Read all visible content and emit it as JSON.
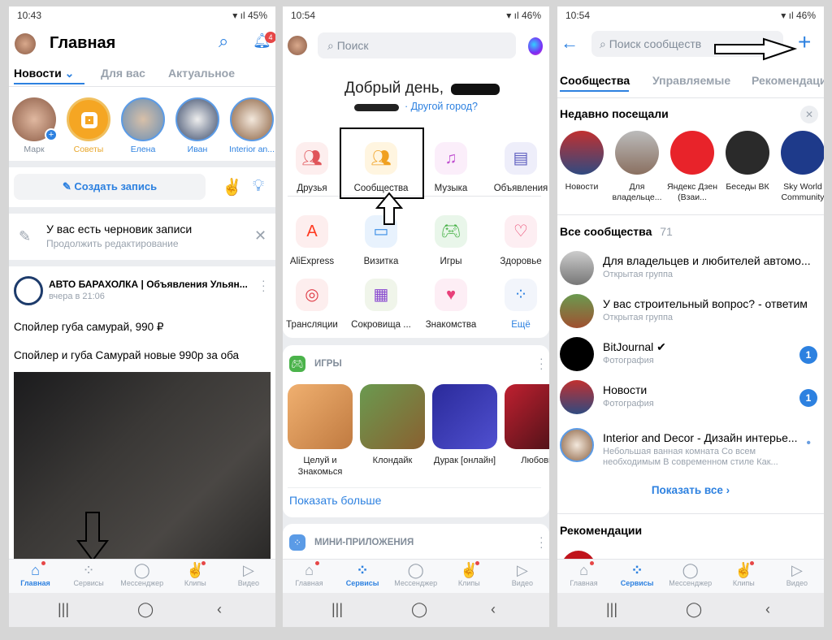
{
  "colors": {
    "accent": "#2d81e0",
    "badge": "#e64646",
    "background": "#d6d6d6"
  },
  "bottom_nav": [
    {
      "label": "Главная",
      "icon": "home-icon"
    },
    {
      "label": "Сервисы",
      "icon": "services-icon"
    },
    {
      "label": "Мессенджер",
      "icon": "messenger-icon"
    },
    {
      "label": "Клипы",
      "icon": "clips-icon"
    },
    {
      "label": "Видео",
      "icon": "video-icon"
    }
  ],
  "screen1": {
    "status": {
      "time": "10:43",
      "battery": "45%"
    },
    "title": "Главная",
    "notifications_badge": "4",
    "tabs": [
      "Новости",
      "Для вас",
      "Актуальное"
    ],
    "stories": [
      "Марк",
      "Советы",
      "Елена",
      "Иван",
      "Interior an..."
    ],
    "create_post": "Создать запись",
    "draft": {
      "title": "У вас есть черновик записи",
      "subtitle": "Продолжить редактирование"
    },
    "post": {
      "author": "АВТО БАРАХОЛКА | Объявления Ульян...",
      "time": "вчера в 21:06",
      "line1": "Спойлер губа самурай, 990 ₽",
      "line2": "Спойлер и губа Самурай новые 990р за оба"
    },
    "active_nav": "Главная"
  },
  "screen2": {
    "status": {
      "time": "10:54",
      "battery": "46%"
    },
    "search_placeholder": "Поиск",
    "greeting": "Добрый день,",
    "other_city": "· Другой город?",
    "services": [
      {
        "label": "Друзья",
        "icon": "friends-icon"
      },
      {
        "label": "Сообщества",
        "icon": "communities-icon"
      },
      {
        "label": "Музыка",
        "icon": "music-icon"
      },
      {
        "label": "Объявления",
        "icon": "ads-icon"
      },
      {
        "label": "AliExpress",
        "icon": "aliexpress-icon"
      },
      {
        "label": "Визитка",
        "icon": "card-icon"
      },
      {
        "label": "Игры",
        "icon": "gamepad-icon"
      },
      {
        "label": "Здоровье",
        "icon": "health-icon"
      },
      {
        "label": "Трансляции",
        "icon": "broadcast-icon"
      },
      {
        "label": "Сокровища ...",
        "icon": "treasures-icon"
      },
      {
        "label": "Знакомства",
        "icon": "dating-icon"
      },
      {
        "label": "Ещё",
        "icon": "more-icon"
      }
    ],
    "games_title": "ИГРЫ",
    "games": [
      "Целуй и Знакомься",
      "Клондайк",
      "Дурак [онлайн]",
      "Любовь"
    ],
    "show_more": "Показать больше",
    "mini_apps_title": "МИНИ-ПРИЛОЖЕНИЯ",
    "active_nav": "Сервисы"
  },
  "screen3": {
    "status": {
      "time": "10:54",
      "battery": "46%"
    },
    "search_placeholder": "Поиск сообществ",
    "tabs": [
      "Сообщества",
      "Управляемые",
      "Рекомендаци"
    ],
    "recent_title": "Недавно посещали",
    "recent": [
      "Новости",
      "Для владельце...",
      "Яндекс Дзен (Взаи...",
      "Беседы ВК",
      "Sky World Community"
    ],
    "all_title": "Все сообщества",
    "all_count": "71",
    "communities": [
      {
        "name": "Для владельцев и любителей автомо...",
        "sub": "Открытая группа",
        "badge": ""
      },
      {
        "name": "У вас строительный вопрос? - ответим",
        "sub": "Открытая группа",
        "badge": ""
      },
      {
        "name": "BitJournal ✔",
        "sub": "Фотография",
        "badge": "1"
      },
      {
        "name": "Новости",
        "sub": "Фотография",
        "badge": "1"
      },
      {
        "name": "Interior and Decor - Дизайн интерье...",
        "sub": "Небольшая ванная комната Со всем необходимым В современном стиле Как...",
        "badge": "•"
      }
    ],
    "show_all": "Показать все ›",
    "recommendations_title": "Рекомендации",
    "active_nav": "Сервисы"
  }
}
